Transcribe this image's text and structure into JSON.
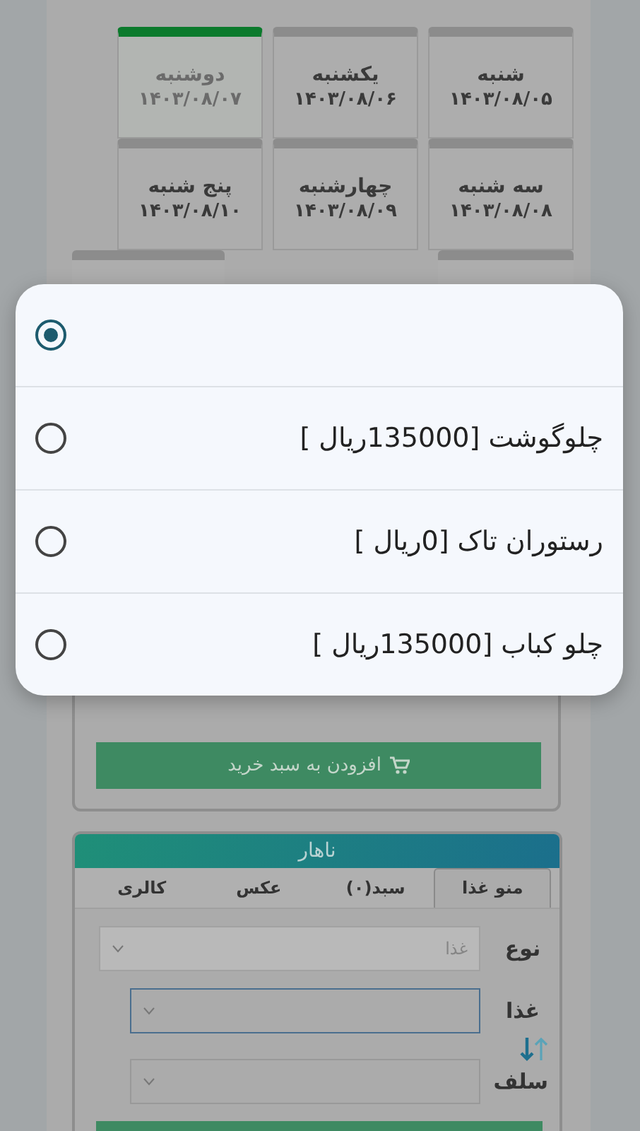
{
  "days": [
    {
      "label": "شنبه",
      "date": "۱۴۰۳/۰۸/۰۵",
      "selected": false
    },
    {
      "label": "یکشنبه",
      "date": "۱۴۰۳/۰۸/۰۶",
      "selected": false
    },
    {
      "label": "دوشنبه",
      "date": "۱۴۰۳/۰۸/۰۷",
      "selected": true
    },
    {
      "label": "سه شنبه",
      "date": "۱۴۰۳/۰۸/۰۸",
      "selected": false
    },
    {
      "label": "چهارشنبه",
      "date": "۱۴۰۳/۰۸/۰۹",
      "selected": false
    },
    {
      "label": "پنج شنبه",
      "date": "۱۴۰۳/۰۸/۱۰",
      "selected": false
    }
  ],
  "add_button": {
    "label": "افزودن به سبد خرید"
  },
  "meal_panel": {
    "title": "ناهار",
    "tabs": [
      {
        "label": "منو غذا",
        "selected": true
      },
      {
        "label": "سبد(۰)",
        "selected": false
      },
      {
        "label": "عکس",
        "selected": false
      },
      {
        "label": "کالری",
        "selected": false
      }
    ],
    "fields": [
      {
        "label": "نوع",
        "value": "غذا",
        "disabled": true,
        "focused": false
      },
      {
        "label": "غذا",
        "disabled": false,
        "focused": true
      },
      {
        "label": "سلف",
        "disabled": false,
        "focused": false
      }
    ]
  },
  "dialog": {
    "options": [
      {
        "selected": true
      },
      {
        "label": "چلوگوشت [135000ریال ]",
        "selected": false
      },
      {
        "label": "رستوران تاک [0ریال ]",
        "selected": false
      },
      {
        "label": "چلو کباب [135000ریال ]",
        "selected": false
      }
    ]
  }
}
